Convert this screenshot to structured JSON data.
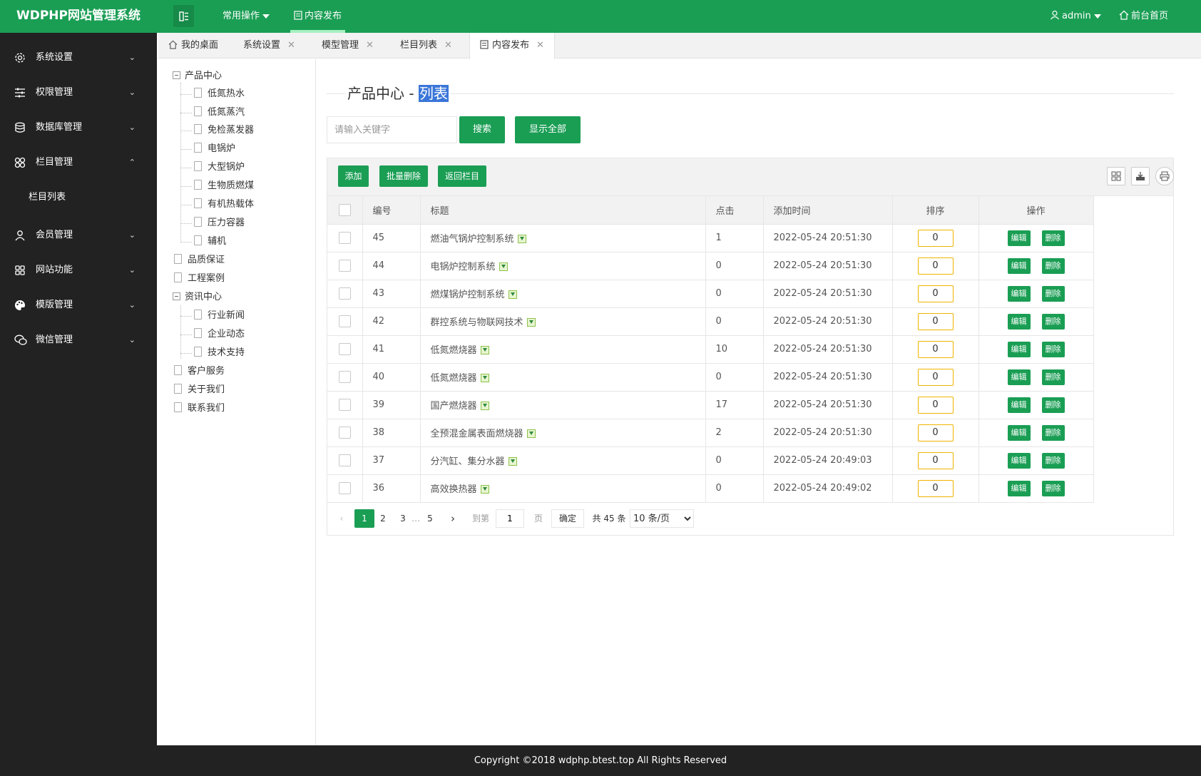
{
  "app": {
    "logo": "WDPHP网站管理系统",
    "top_menu": {
      "common": "常用操作",
      "publish": "内容发布"
    },
    "user": "admin",
    "home_link": "前台首页"
  },
  "sidebar": {
    "items": [
      {
        "label": "系统设置",
        "icon": "gear-icon",
        "chevron": "⌄"
      },
      {
        "label": "权限管理",
        "icon": "sliders-icon",
        "chevron": "⌄"
      },
      {
        "label": "数据库管理",
        "icon": "database-icon",
        "chevron": "⌄"
      },
      {
        "label": "栏目管理",
        "icon": "grid-icon",
        "chevron": "⌃"
      },
      {
        "label": "会员管理",
        "icon": "user-icon",
        "chevron": "⌄"
      },
      {
        "label": "网站功能",
        "icon": "apps-icon",
        "chevron": "⌄"
      },
      {
        "label": "模版管理",
        "icon": "palette-icon",
        "chevron": "⌄"
      },
      {
        "label": "微信管理",
        "icon": "wechat-icon",
        "chevron": "⌄"
      }
    ],
    "sub_item": "栏目列表"
  },
  "tabs": [
    {
      "label": "我的桌面"
    },
    {
      "label": "系统设置"
    },
    {
      "label": "模型管理"
    },
    {
      "label": "栏目列表"
    },
    {
      "label": "内容发布"
    }
  ],
  "tree": {
    "nodes": [
      "产品中心",
      "低氮热水",
      "低氮蒸汽",
      "免检蒸发器",
      "电锅炉",
      "大型锅炉",
      "生物质燃煤",
      "有机热载体",
      "压力容器",
      "辅机",
      "品质保证",
      "工程案例",
      "资讯中心",
      "行业新闻",
      "企业动态",
      "技术支持",
      "客户服务",
      "关于我们",
      "联系我们"
    ]
  },
  "page": {
    "title_prefix": "产品中心 - ",
    "title_highlight": "列表",
    "search_placeholder": "请输入关键字",
    "search_button": "搜索",
    "show_all_button": "显示全部"
  },
  "toolbar": {
    "add": "添加",
    "batch_delete": "批量删除",
    "back": "返回栏目"
  },
  "table": {
    "headers": {
      "id": "编号",
      "title": "标题",
      "clicks": "点击",
      "time": "添加时间",
      "sort": "排序",
      "ops": "操作"
    },
    "edit_label": "编辑",
    "delete_label": "删除",
    "rows": [
      {
        "id": "45",
        "title": "燃油气锅炉控制系统",
        "clicks": "1",
        "time": "2022-05-24 20:51:30",
        "sort": "0"
      },
      {
        "id": "44",
        "title": "电锅炉控制系统",
        "clicks": "0",
        "time": "2022-05-24 20:51:30",
        "sort": "0"
      },
      {
        "id": "43",
        "title": "燃煤锅炉控制系统",
        "clicks": "0",
        "time": "2022-05-24 20:51:30",
        "sort": "0"
      },
      {
        "id": "42",
        "title": "群控系统与物联网技术",
        "clicks": "0",
        "time": "2022-05-24 20:51:30",
        "sort": "0"
      },
      {
        "id": "41",
        "title": "低氮燃烧器",
        "clicks": "10",
        "time": "2022-05-24 20:51:30",
        "sort": "0"
      },
      {
        "id": "40",
        "title": "低氮燃烧器",
        "clicks": "0",
        "time": "2022-05-24 20:51:30",
        "sort": "0"
      },
      {
        "id": "39",
        "title": "国产燃烧器",
        "clicks": "17",
        "time": "2022-05-24 20:51:30",
        "sort": "0"
      },
      {
        "id": "38",
        "title": "全预混金属表面燃烧器",
        "clicks": "2",
        "time": "2022-05-24 20:51:30",
        "sort": "0"
      },
      {
        "id": "37",
        "title": "分汽缸、集分水器",
        "clicks": "0",
        "time": "2022-05-24 20:49:03",
        "sort": "0"
      },
      {
        "id": "36",
        "title": "高效换热器",
        "clicks": "0",
        "time": "2022-05-24 20:49:02",
        "sort": "0"
      }
    ]
  },
  "pager": {
    "pages": [
      "1",
      "2",
      "3",
      "…",
      "5"
    ],
    "current": "1",
    "goto_label": "到第",
    "goto_value": "1",
    "page_unit": "页",
    "confirm": "确定",
    "total": "共 45 条",
    "per_page": "10 条/页"
  },
  "footer": "Copyright ©2018 wdphp.btest.top All Rights Reserved",
  "colors": {
    "primary": "#1a9e54",
    "sidebar": "#222222",
    "highlight": "#3a76d8"
  }
}
